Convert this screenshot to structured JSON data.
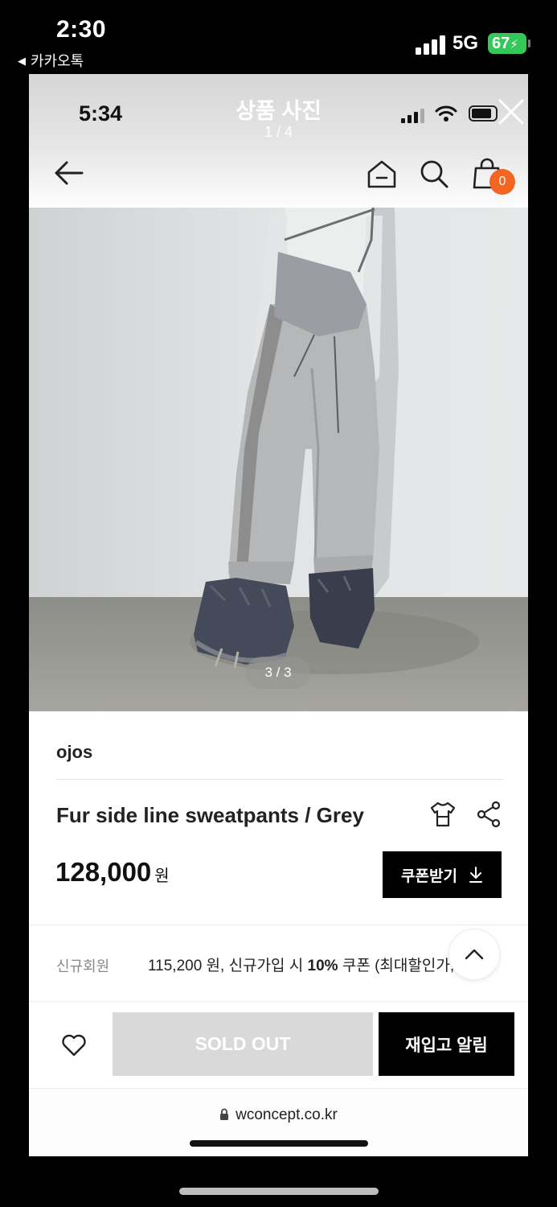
{
  "outer_status": {
    "time": "2:30",
    "back_app": "카카오톡",
    "network": "5G",
    "battery": "67"
  },
  "inner_status": {
    "time": "5:34"
  },
  "viewer": {
    "title": "상품 사진",
    "counter": "1 / 4"
  },
  "nav": {
    "cart_count": "0",
    "badge_color": "#f26522"
  },
  "photo": {
    "counter": "3 / 3"
  },
  "product": {
    "brand": "ojos",
    "name": "Fur side line sweatpants / Grey",
    "price": "128,000",
    "currency": "원",
    "coupon_label": "쿠폰받기"
  },
  "member": {
    "label": "신규회원",
    "price_text": "115,200 원, 신규가입 시 ",
    "discount": "10%",
    "coupon_text": " 쿠폰 (최대할인가,"
  },
  "actions": {
    "soldout_label": "SOLD OUT",
    "restock_label": "재입고 알림"
  },
  "browser": {
    "url": "wconcept.co.kr"
  }
}
